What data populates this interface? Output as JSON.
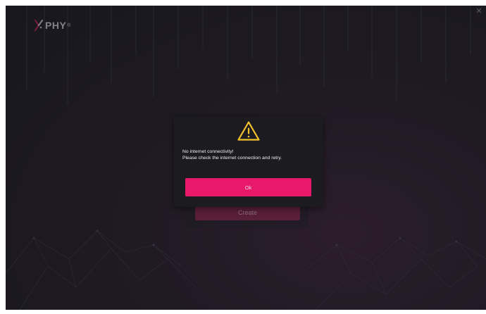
{
  "app": {
    "logo_text": "PHY",
    "logo_superscript": "®",
    "close_glyph": "✕"
  },
  "background_form": {
    "create_label": "Create"
  },
  "dialog": {
    "icon": "warning-triangle-icon",
    "message_line1": "No internet connectivity!",
    "message_line2": "Please check the internet connection and retry.",
    "ok_label": "Ok"
  },
  "colors": {
    "accent": "#e8196b",
    "warning": "#f2c12e",
    "dialog_bg": "#1b1b20",
    "app_bg": "#1f1a24"
  }
}
